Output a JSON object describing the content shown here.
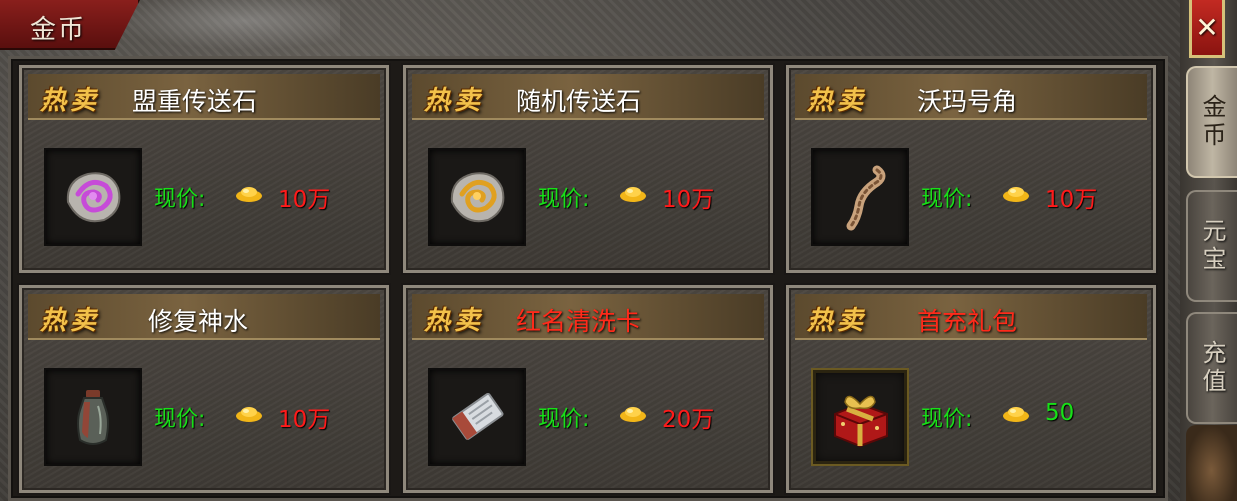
{
  "window": {
    "title": "金币",
    "close_label": "✕"
  },
  "side_tabs": [
    {
      "label": "金币",
      "active": true
    },
    {
      "label": "元宝",
      "active": false
    },
    {
      "label": "充值",
      "active": false
    }
  ],
  "hot_badge": "热卖",
  "price_label": "现价:",
  "currency_icon": "gold-ingot-icon",
  "items": [
    {
      "name": "盟重传送石",
      "name_color": "white",
      "price": "10万",
      "price_color": "red",
      "icon": "purple-teleport-stone-icon"
    },
    {
      "name": "随机传送石",
      "name_color": "white",
      "price": "10万",
      "price_color": "red",
      "icon": "gold-teleport-stone-icon"
    },
    {
      "name": "沃玛号角",
      "name_color": "white",
      "price": "10万",
      "price_color": "red",
      "icon": "horn-icon"
    },
    {
      "name": "修复神水",
      "name_color": "white",
      "price": "10万",
      "price_color": "red",
      "icon": "potion-bottle-icon"
    },
    {
      "name": "红名清洗卡",
      "name_color": "red",
      "price": "20万",
      "price_color": "red",
      "icon": "cleanse-card-icon"
    },
    {
      "name": "首充礼包",
      "name_color": "red",
      "price": "50",
      "price_color": "green",
      "icon": "gift-box-icon"
    }
  ],
  "colors": {
    "price_label": "#18e018",
    "price_red": "#ff1a1a",
    "name_red": "#ff2a1a",
    "badge_gold": "#f2c14a"
  }
}
